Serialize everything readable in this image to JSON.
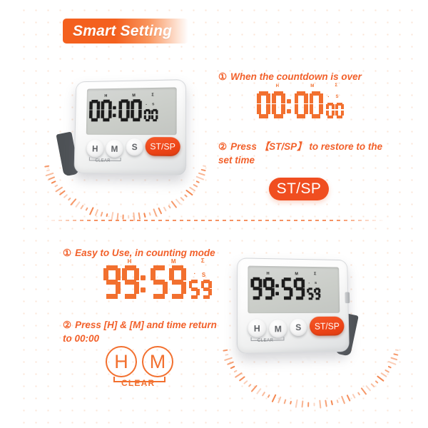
{
  "header": {
    "title": "Smart Setting",
    "badge_color": "#F4601E"
  },
  "colors": {
    "accent": "#F2702F",
    "accent_strong": "#F04E20",
    "lcd_digit": "#1c1c1c",
    "text": "#F2602A"
  },
  "section_top": {
    "device": {
      "name": "kitchen-timer",
      "display": {
        "hours": "00",
        "minutes": "00",
        "seconds": "00"
      },
      "labels": {
        "h": "H",
        "m": "M",
        "s": "S",
        "sigma": "Σ"
      },
      "buttons": {
        "h": "H",
        "m": "M",
        "s": "S",
        "stsp": "ST/SP"
      },
      "clear_label": "CLEAR"
    },
    "steps": [
      {
        "num": "①",
        "text": "When the countdown is over"
      },
      {
        "num": "②",
        "text": "Press 【ST/SP】 to restore to the set time"
      }
    ],
    "display": {
      "hours": "00",
      "minutes": "00",
      "seconds": "00"
    },
    "display_labels": {
      "h": "H",
      "m": "M",
      "s": "S",
      "sigma": "Σ"
    },
    "stsp_pill": "ST/SP"
  },
  "section_bottom": {
    "steps": [
      {
        "num": "①",
        "text": "Easy to Use, in counting mode"
      },
      {
        "num": "②",
        "text": "Press [H] & [M] and time return to 00:00"
      }
    ],
    "display": {
      "hours": "99",
      "minutes": "59",
      "seconds": "59"
    },
    "display_labels": {
      "h": "H",
      "m": "M",
      "s": "S",
      "sigma": "Σ"
    },
    "keys": {
      "h": "H",
      "m": "M",
      "clear": "CLEAR"
    },
    "device": {
      "name": "kitchen-timer",
      "display": {
        "hours": "99",
        "minutes": "59",
        "seconds": "59"
      },
      "labels": {
        "h": "H",
        "m": "M",
        "s": "S",
        "sigma": "Σ"
      },
      "buttons": {
        "h": "H",
        "m": "M",
        "s": "S",
        "stsp": "ST/SP"
      },
      "clear_label": "CLEAR"
    }
  }
}
